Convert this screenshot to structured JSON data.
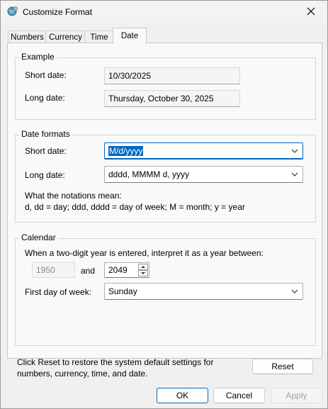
{
  "window": {
    "title": "Customize Format",
    "close_icon": "close-icon",
    "app_icon": "globe-settings-icon"
  },
  "tabs": [
    {
      "label": "Numbers",
      "active": false
    },
    {
      "label": "Currency",
      "active": false
    },
    {
      "label": "Time",
      "active": false
    },
    {
      "label": "Date",
      "active": true
    }
  ],
  "example": {
    "title": "Example",
    "short_date_label": "Short date:",
    "short_date_value": "10/30/2025",
    "long_date_label": "Long date:",
    "long_date_value": "Thursday, October 30, 2025"
  },
  "date_formats": {
    "title": "Date formats",
    "short_date_label": "Short date:",
    "short_date_value": "M/d/yyyy",
    "long_date_label": "Long date:",
    "long_date_value": "dddd, MMMM d, yyyy",
    "notation_heading": "What the notations mean:",
    "notation_text": "d, dd = day;  ddd, dddd = day of week;  M = month;  y = year"
  },
  "calendar": {
    "title": "Calendar",
    "two_digit_label": "When a two-digit year is entered, interpret it as a year between:",
    "start_year": "1950",
    "and_label": "and",
    "end_year": "2049",
    "first_day_label": "First day of week:",
    "first_day_value": "Sunday"
  },
  "reset": {
    "text_line1": "Click Reset to restore the system default settings for",
    "text_line2": "numbers, currency, time, and date.",
    "button_label": "Reset"
  },
  "footer": {
    "ok_label": "OK",
    "cancel_label": "Cancel",
    "apply_label": "Apply"
  },
  "colors": {
    "accent": "#0067c0",
    "background": "#f0f0f0",
    "panel": "#f9f9f9"
  }
}
